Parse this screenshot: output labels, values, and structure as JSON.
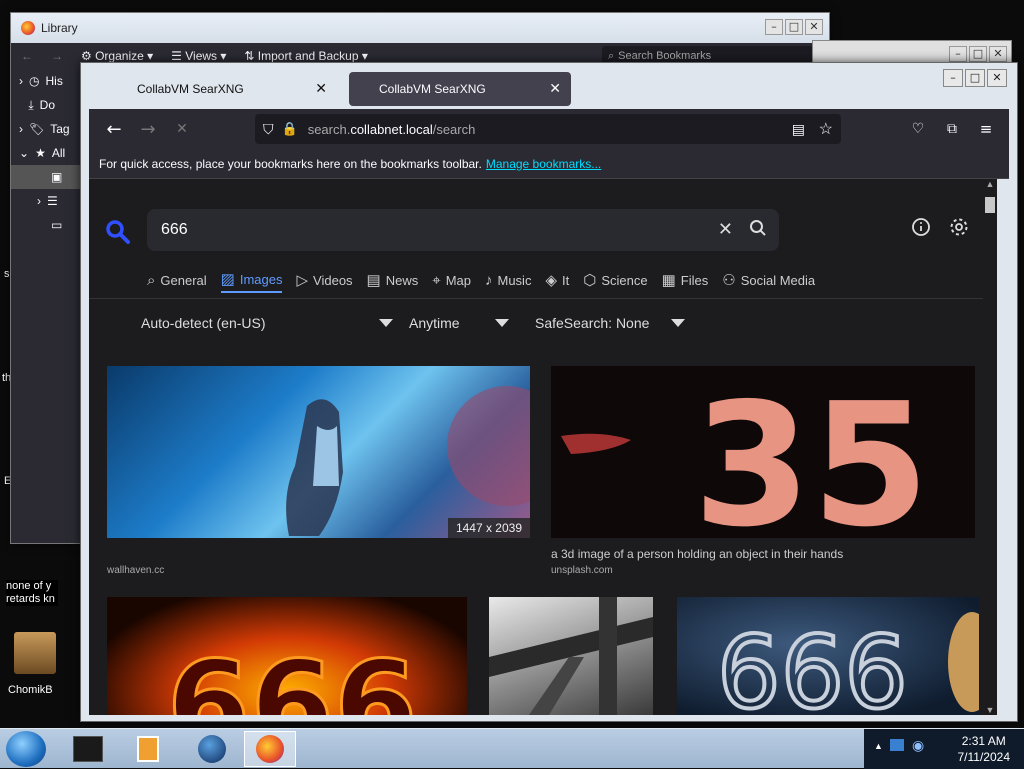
{
  "desktop": {
    "text_s": "s",
    "text_th": "th",
    "text_e": "E",
    "note_line1": "none of y",
    "note_line2": "retards kn",
    "icon_label": "ChomikB"
  },
  "library": {
    "title": "Library",
    "toolbar": {
      "organize": "Organize",
      "views": "Views",
      "import_backup": "Import and Backup",
      "search_placeholder": "Search Bookmarks"
    },
    "sidebar": [
      "His",
      "Do",
      "Tag",
      "All"
    ]
  },
  "browser": {
    "tabs": [
      {
        "label": "CollabVM SearXNG",
        "active": false
      },
      {
        "label": "CollabVM SearXNG",
        "active": true
      }
    ],
    "url": {
      "prefix": "search.",
      "host": "collabnet.local",
      "path": "/search"
    },
    "bookmarks_bar": {
      "message": "For quick access, place your bookmarks here on the bookmarks toolbar.",
      "link": "Manage bookmarks..."
    }
  },
  "search": {
    "query": "666",
    "categories": [
      {
        "label": "General",
        "icon": "search-icon",
        "active": false
      },
      {
        "label": "Images",
        "icon": "image-icon",
        "active": true
      },
      {
        "label": "Videos",
        "icon": "play-icon",
        "active": false
      },
      {
        "label": "News",
        "icon": "newspaper-icon",
        "active": false
      },
      {
        "label": "Map",
        "icon": "map-pin-icon",
        "active": false
      },
      {
        "label": "Music",
        "icon": "music-note-icon",
        "active": false
      },
      {
        "label": "It",
        "icon": "layers-icon",
        "active": false
      },
      {
        "label": "Science",
        "icon": "cube-icon",
        "active": false
      },
      {
        "label": "Files",
        "icon": "files-icon",
        "active": false
      },
      {
        "label": "Social Media",
        "icon": "people-icon",
        "active": false
      }
    ],
    "filters": {
      "language": "Auto-detect (en-US)",
      "time": "Anytime",
      "safesearch": "SafeSearch: None"
    }
  },
  "results": [
    {
      "dims": "1447 x 2039",
      "caption": "",
      "source": "wallhaven.cc"
    },
    {
      "dims": "",
      "caption": "a 3d image of a person holding an object in their hands",
      "source": "unsplash.com"
    },
    {
      "dims": "",
      "caption": "",
      "source": ""
    },
    {
      "dims": "",
      "caption": "",
      "source": ""
    },
    {
      "dims": "",
      "caption": "",
      "source": ""
    }
  ],
  "taskbar": {
    "time": "2:31 AM",
    "date": "7/11/2024"
  }
}
